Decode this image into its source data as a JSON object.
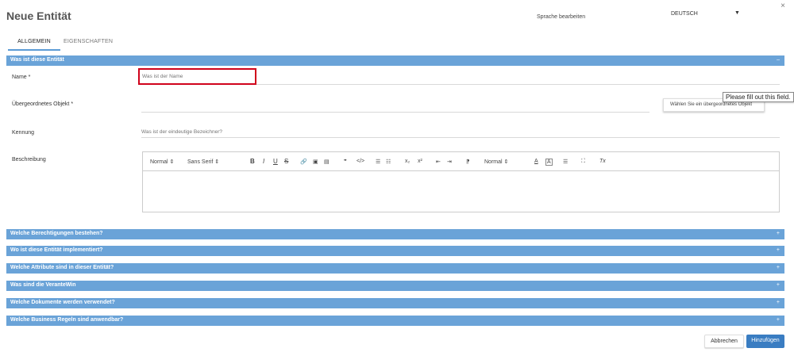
{
  "header": {
    "title": "Neue Entität",
    "close_symbol": "×",
    "language_label": "Sprache bearbeiten",
    "language_value": "DEUTSCH",
    "language_caret": "▼"
  },
  "tabs": [
    {
      "label": "ALLGEMEIN",
      "active": true
    },
    {
      "label": "EIGENSCHAFTEN",
      "active": false
    }
  ],
  "main_section": {
    "title": "Was ist diese Entität",
    "toggle": "–"
  },
  "fields": {
    "name": {
      "label": "Name *",
      "placeholder": "Was ist der Name"
    },
    "parent": {
      "label": "Übergeordnetes Objekt *",
      "button": "Wählen Sie ein übergeordnetes Objekt",
      "tooltip": "Please fill out this field."
    },
    "identifier": {
      "label": "Kennung",
      "placeholder": "Was ist der eindeutige Bezeichner?"
    },
    "description": {
      "label": "Beschreibung"
    }
  },
  "toolbar": {
    "heading": "Normal ⇕",
    "font": "Sans Serif ⇕",
    "bold": "B",
    "italic": "I",
    "underline": "U",
    "strike": "S",
    "link": "🔗",
    "image": "▣",
    "video": "▤",
    "quote": "❞",
    "code": "</>",
    "ordered_list": "☰",
    "bullet_list": "☷",
    "subscript": "x₂",
    "superscript": "x²",
    "outdent": "⇤",
    "indent": "⇥",
    "direction": "⁋",
    "size": "Normal ⇕",
    "color": "A",
    "background": "A",
    "align": "☰",
    "fullscreen": "⛶",
    "clean": "Tx"
  },
  "collapsed_sections": [
    {
      "title": "Welche Berechtigungen bestehen?",
      "toggle": "+"
    },
    {
      "title": "Wo ist diese Entität implementiert?",
      "toggle": "+"
    },
    {
      "title": "Welche Attribute sind in dieser Entität?",
      "toggle": "+"
    },
    {
      "title": "Was sind die VeranteWin",
      "toggle": "+"
    },
    {
      "title": "Welche Dokumente werden verwendet?",
      "toggle": "+"
    },
    {
      "title": "Welche Business Regeln sind anwendbar?",
      "toggle": "+"
    }
  ],
  "footer": {
    "cancel": "Abbrechen",
    "add": "Hinzufügen"
  },
  "colors": {
    "section_bar": "#6aa3d8",
    "primary_button": "#3a7dc2",
    "error_border": "#d0021b"
  }
}
